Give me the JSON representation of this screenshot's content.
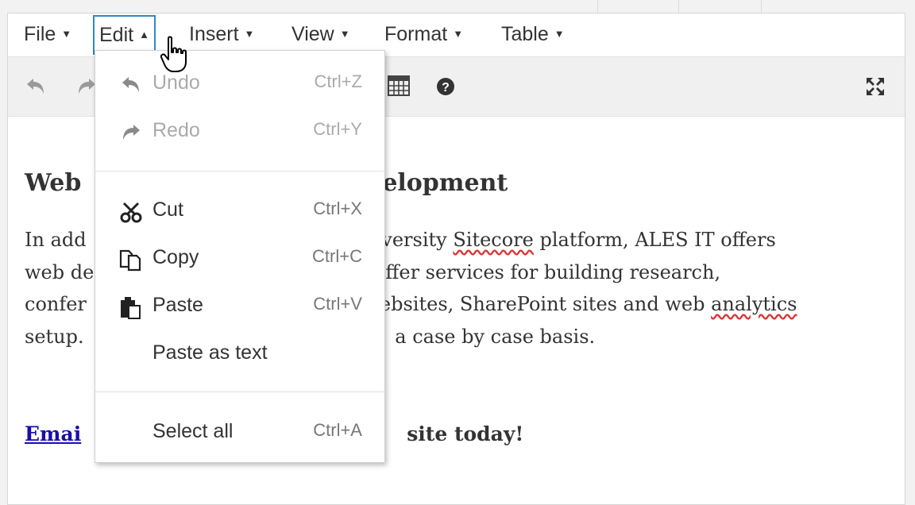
{
  "menubar": {
    "items": [
      {
        "label": "File",
        "caret": "▼"
      },
      {
        "label": "Edit",
        "caret": "▲"
      },
      {
        "label": "Insert",
        "caret": "▼"
      },
      {
        "label": "View",
        "caret": "▼"
      },
      {
        "label": "Format",
        "caret": "▼"
      },
      {
        "label": "Table",
        "caret": "▼"
      }
    ],
    "active": "Edit"
  },
  "toolbar": {
    "icons": [
      "undo-icon",
      "redo-icon",
      "table-icon",
      "help-icon",
      "fullscreen-icon"
    ]
  },
  "edit_menu": {
    "items": [
      {
        "label": "Undo",
        "shortcut": "Ctrl+Z",
        "icon": "undo-icon",
        "disabled": true
      },
      {
        "label": "Redo",
        "shortcut": "Ctrl+Y",
        "icon": "redo-icon",
        "disabled": true
      },
      {
        "label": "Cut",
        "shortcut": "Ctrl+X",
        "icon": "scissors-icon"
      },
      {
        "label": "Copy",
        "shortcut": "Ctrl+C",
        "icon": "copy-icon"
      },
      {
        "label": "Paste",
        "shortcut": "Ctrl+V",
        "icon": "paste-icon"
      },
      {
        "label": "Paste as text",
        "shortcut": ""
      },
      {
        "label": "Select all",
        "shortcut": "Ctrl+A"
      }
    ]
  },
  "content": {
    "heading_left": "Web",
    "heading_right": "elopment",
    "para_lines": [
      {
        "left": "In add",
        "right": "iversity ",
        "squiggle": "Sitecore",
        "tail": " platform, ALES IT offers"
      },
      {
        "left": "web de",
        "right": "ffer services for building research,"
      },
      {
        "left": "confer",
        "right": "ebsites, SharePoint sites and web ",
        "squiggle": "analytics"
      },
      {
        "left": "setup.",
        "right": " a case by case basis."
      }
    ],
    "cta_link": "Emai",
    "cta_tail": "site today!"
  },
  "colors": {
    "accent": "#2d8ac7",
    "link": "#1a0dab",
    "spellcheck": "#dd3333"
  }
}
